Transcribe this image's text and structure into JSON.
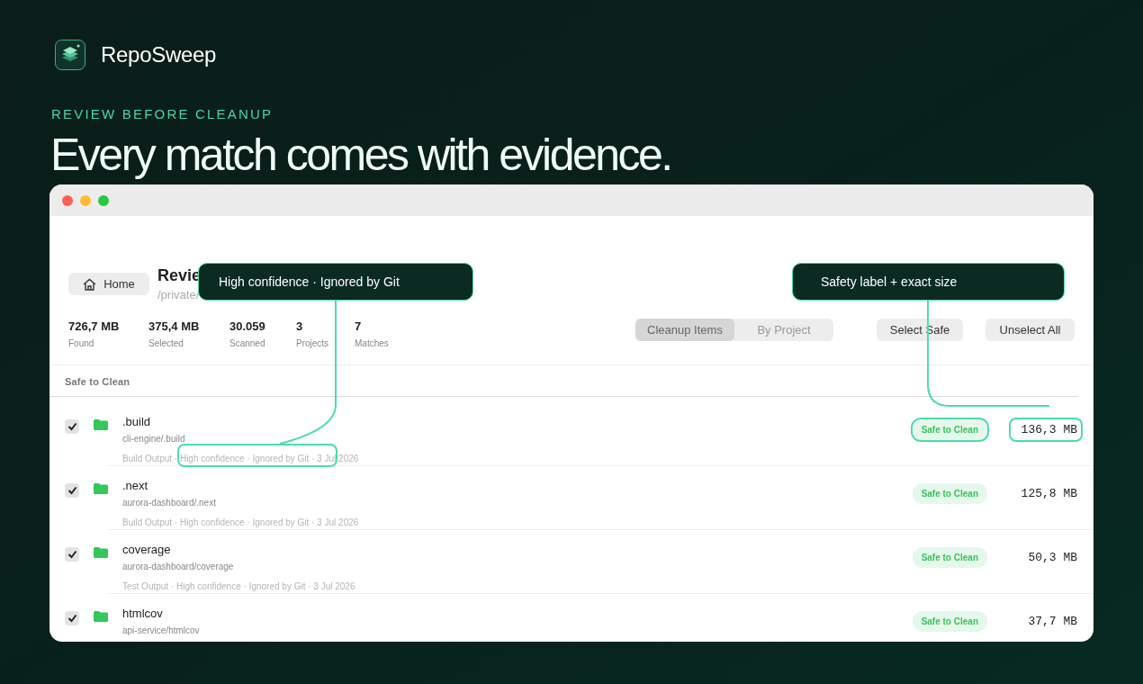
{
  "brand": {
    "name": "RepoSweep"
  },
  "eyebrow": "REVIEW BEFORE CLEANUP",
  "headline": "Every match comes with evidence.",
  "window": {
    "home_button": "Home",
    "title": "Revie",
    "path": "/private/"
  },
  "stats": [
    {
      "value": "726,7 MB",
      "label": "Found"
    },
    {
      "value": "375,4 MB",
      "label": "Selected"
    },
    {
      "value": "30.059",
      "label": "Scanned"
    },
    {
      "value": "3",
      "label": "Projects"
    },
    {
      "value": "7",
      "label": "Matches"
    }
  ],
  "view_tabs": [
    {
      "label": "Cleanup Items",
      "selected": true
    },
    {
      "label": "By Project",
      "selected": false
    }
  ],
  "buttons": [
    "Select Safe",
    "Unselect All"
  ],
  "group": "Safe to Clean",
  "rows": [
    {
      "checked": true,
      "highlighted": true,
      "name": ".build",
      "path": "cli-engine/.build",
      "meta": "Build Output · High confidence · Ignored by Git · 3 Jul 2026",
      "badge": "Safe to Clean",
      "size": "136,3 MB"
    },
    {
      "checked": true,
      "highlighted": false,
      "name": ".next",
      "path": "aurora-dashboard/.next",
      "meta": "Build Output · High confidence · Ignored by Git · 3 Jul 2026",
      "badge": "Safe to Clean",
      "size": "125,8 MB"
    },
    {
      "checked": true,
      "highlighted": false,
      "name": "coverage",
      "path": "aurora-dashboard/coverage",
      "meta": "Test Output · High confidence · Ignored by Git · 3 Jul 2026",
      "badge": "Safe to Clean",
      "size": "50,3 MB"
    },
    {
      "checked": true,
      "highlighted": false,
      "name": "htmlcov",
      "path": "api-service/htmlcov",
      "badge": "Safe to Clean",
      "size": "37,7 MB"
    }
  ],
  "callouts": [
    "High confidence · Ignored by Git",
    "Safety label + exact size"
  ]
}
